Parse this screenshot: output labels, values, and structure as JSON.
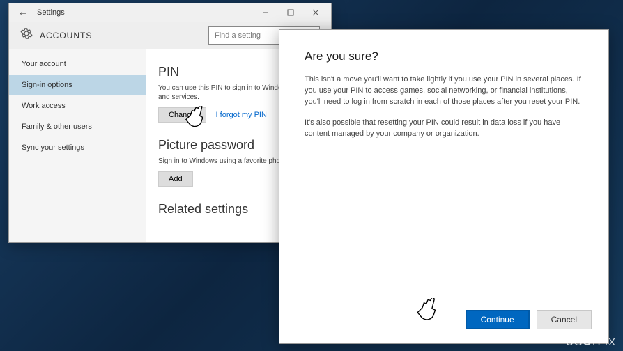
{
  "settings": {
    "windowTitle": "Settings",
    "header": "ACCOUNTS",
    "searchPlaceholder": "Find a setting",
    "sidebar": [
      "Your account",
      "Sign-in options",
      "Work access",
      "Family & other users",
      "Sync your settings"
    ],
    "pin": {
      "title": "PIN",
      "body": "You can use this PIN to sign in to Windows, apps, and services.",
      "change": "Change",
      "forgot": "I forgot my PIN"
    },
    "picpass": {
      "title": "Picture password",
      "body": "Sign in to Windows using a favorite photo.",
      "add": "Add"
    },
    "related": "Related settings"
  },
  "dialog": {
    "title": "Are you sure?",
    "p1": "This isn't a move you'll want to take lightly if you use your PIN in several places. If you use your PIN to access games, social networking, or financial institutions, you'll need to log in from scratch in each of those places after you reset your PIN.",
    "p2": "It's also possible that resetting your PIN could result in data loss if you have content managed by your company or organization.",
    "continue": "Continue",
    "cancel": "Cancel"
  },
  "watermark": "UGETFIX"
}
